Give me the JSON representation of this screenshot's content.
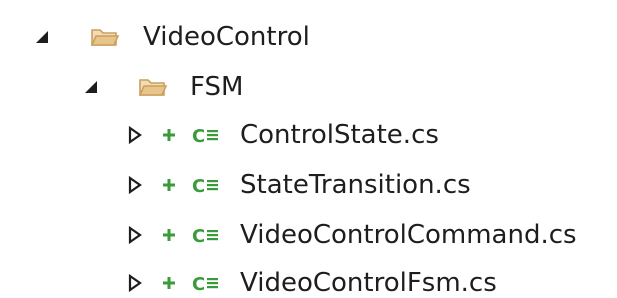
{
  "tree": {
    "root": {
      "label": "VideoControl",
      "icon": "folder-open-icon",
      "expanded": true
    },
    "folder": {
      "label": "FSM",
      "icon": "folder-open-icon",
      "expanded": true
    },
    "files": [
      {
        "label": "ControlState.cs",
        "status_icon": "pending-add-icon",
        "type_icon": "csharp-file-icon",
        "expanded": false
      },
      {
        "label": "StateTransition.cs",
        "status_icon": "pending-add-icon",
        "type_icon": "csharp-file-icon",
        "expanded": false
      },
      {
        "label": "VideoControlCommand.cs",
        "status_icon": "pending-add-icon",
        "type_icon": "csharp-file-icon",
        "expanded": false
      },
      {
        "label": "VideoControlFsm.cs",
        "status_icon": "pending-add-icon",
        "type_icon": "csharp-file-icon",
        "expanded": false
      }
    ]
  },
  "colors": {
    "folder_fill": "#e8c58a",
    "folder_stroke": "#c9a061",
    "add_green": "#3a9b3a",
    "csharp_green": "#3a9b3a",
    "arrow": "#1e1e1e",
    "text": "#1e1e1e"
  }
}
